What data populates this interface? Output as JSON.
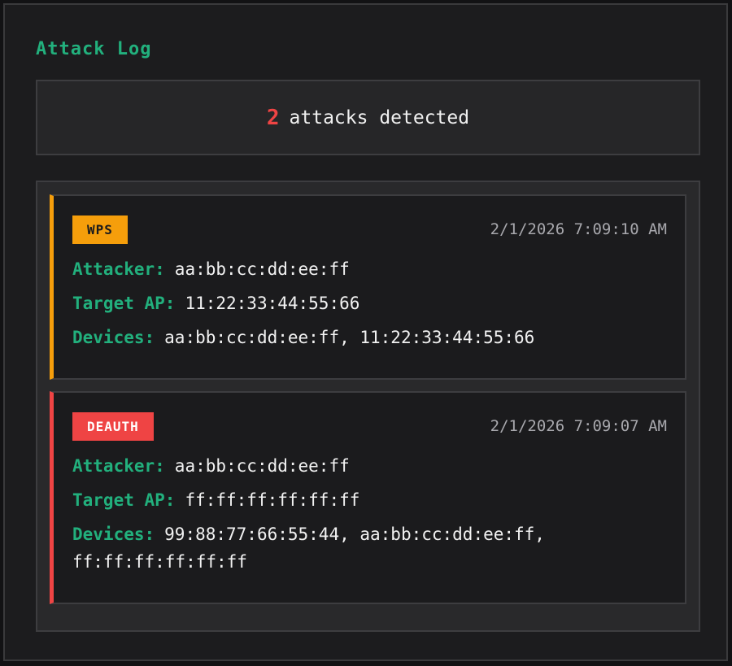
{
  "title": "Attack Log",
  "summary": {
    "count": "2",
    "text": "attacks detected"
  },
  "labels": {
    "attacker": "Attacker:",
    "target_ap": "Target AP:",
    "devices": "Devices:"
  },
  "entries": [
    {
      "type": "WPS",
      "color": "#f59e0b",
      "timestamp": "2/1/2026 7:09:10 AM",
      "attacker": "aa:bb:cc:dd:ee:ff",
      "target_ap": "11:22:33:44:55:66",
      "devices": "aa:bb:cc:dd:ee:ff, 11:22:33:44:55:66"
    },
    {
      "type": "DEAUTH",
      "color": "#ef4444",
      "timestamp": "2/1/2026 7:09:07 AM",
      "attacker": "aa:bb:cc:dd:ee:ff",
      "target_ap": "ff:ff:ff:ff:ff:ff",
      "devices": "99:88:77:66:55:44, aa:bb:cc:dd:ee:ff, ff:ff:ff:ff:ff:ff"
    }
  ],
  "colors": {
    "accent": "#22b07d",
    "danger": "#ef4444",
    "warning": "#f59e0b"
  }
}
